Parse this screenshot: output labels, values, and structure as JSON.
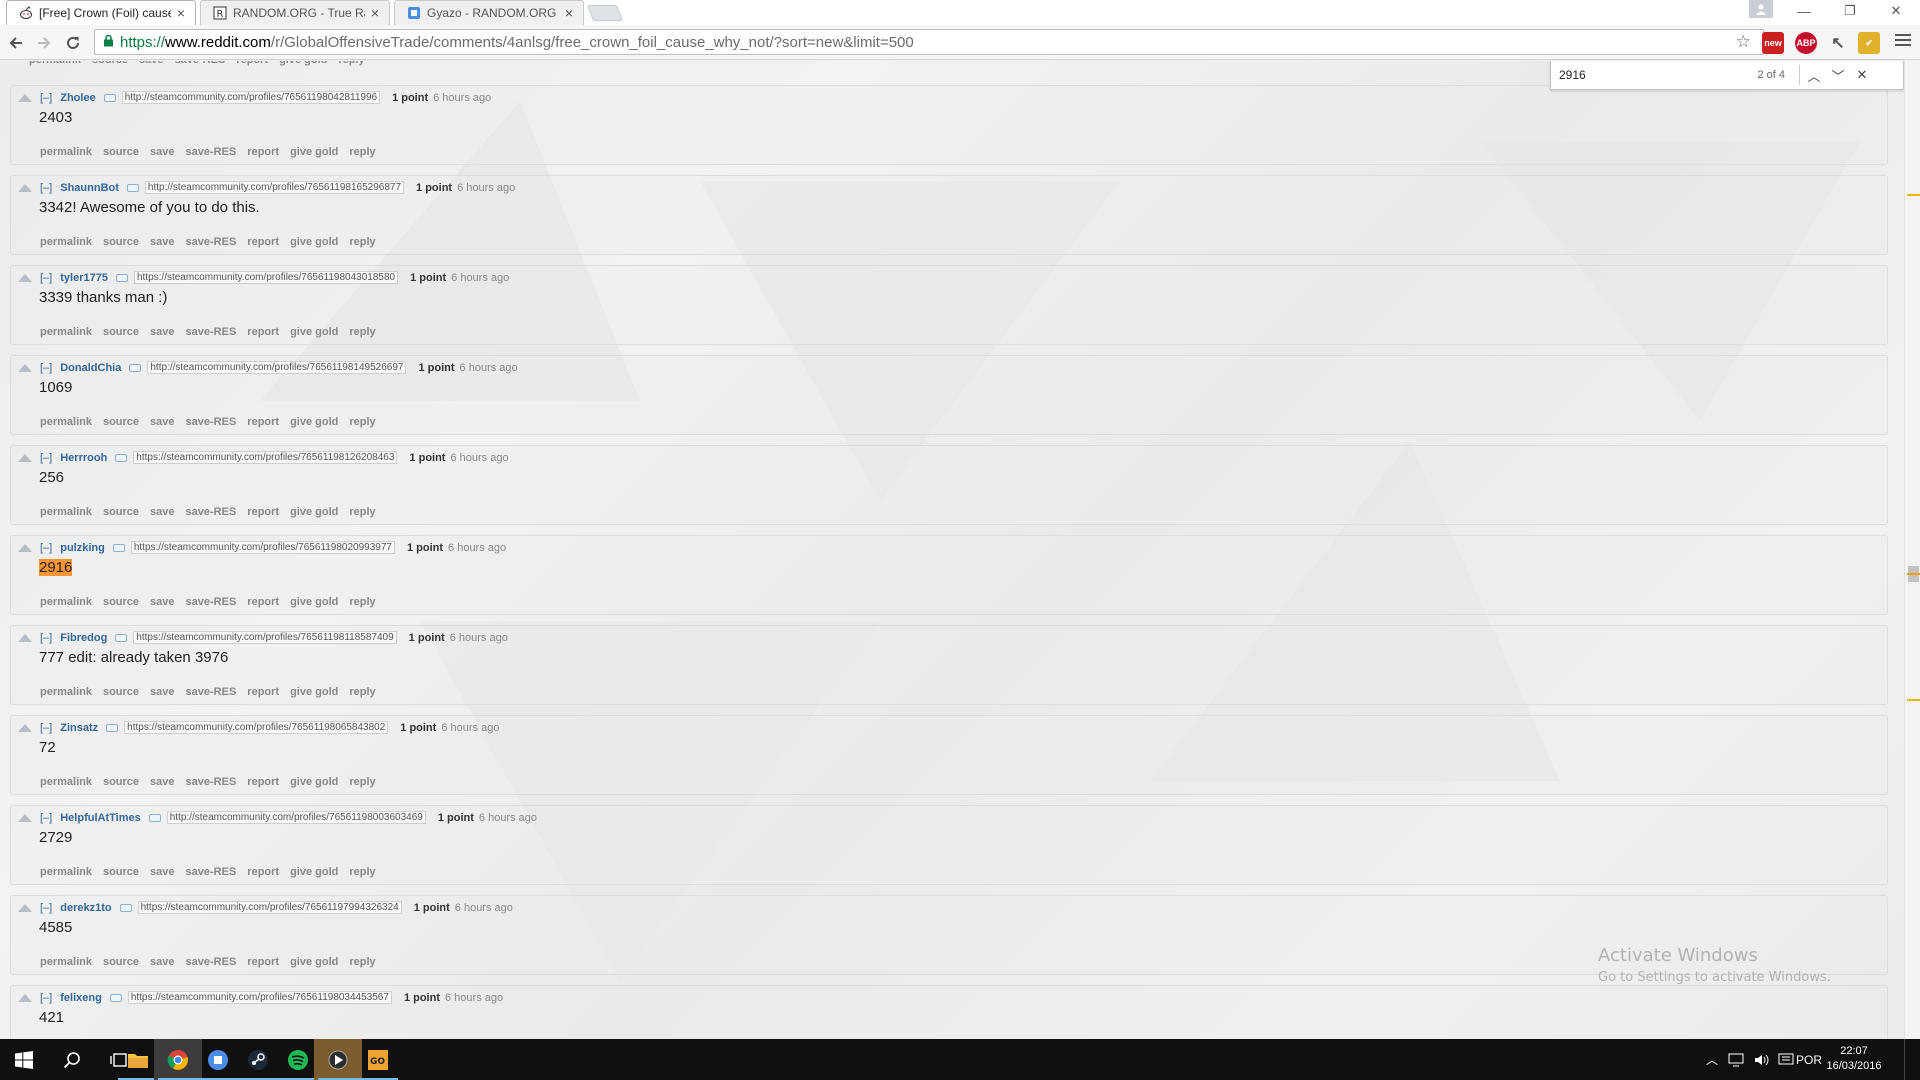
{
  "tabs": [
    {
      "title": "[Free] Crown (Foil) cause",
      "close": "×"
    },
    {
      "title": "RANDOM.ORG - True Ran",
      "close": "×"
    },
    {
      "title": "Gyazo - RANDOM.ORG -",
      "close": "×"
    }
  ],
  "window_controls": {
    "minimize": "—",
    "restore": "❐",
    "close": "✕"
  },
  "toolbar": {
    "url_scheme": "https://",
    "url_host": "www.reddit.com",
    "url_path": "/r/GlobalOffensiveTrade/comments/4anlsg/free_crown_foil_cause_why_not/?sort=new&limit=500",
    "extensions": [
      {
        "name": "mail-new-extension-icon",
        "label": "new",
        "color": "#cc1f1f"
      },
      {
        "name": "adblock-plus-icon",
        "label": "ABP",
        "color": "#c70d2c"
      },
      {
        "name": "cursor-extension-icon",
        "label": "↖",
        "color": "#555555"
      },
      {
        "name": "checkmark-extension-icon",
        "label": "✔",
        "color": "#e1b12c"
      }
    ]
  },
  "findbar": {
    "query": "2916",
    "count": "2 of 4",
    "prev": "︿",
    "next": "﹀",
    "close": "✕"
  },
  "top_buttons": [
    "permalink",
    "source",
    "save",
    "save-RES",
    "report",
    "give gold",
    "reply"
  ],
  "comments": [
    {
      "expand": "[–]",
      "author": "Zholee",
      "flair": "http://steamcommunity.com/profiles/76561198042811996",
      "score": "1 point",
      "time": "6 hours ago",
      "body": "2403",
      "highlight": false
    },
    {
      "expand": "[–]",
      "author": "ShaunnBot",
      "flair": "http://steamcommunity.com/profiles/76561198165296877",
      "score": "1 point",
      "time": "6 hours ago",
      "body": "3342! Awesome of you to do this.",
      "highlight": false
    },
    {
      "expand": "[–]",
      "author": "tyler1775",
      "flair": "https://steamcommunity.com/profiles/76561198043018580",
      "score": "1 point",
      "time": "6 hours ago",
      "body": "3339 thanks man :)",
      "highlight": false
    },
    {
      "expand": "[–]",
      "author": "DonaldChia",
      "flair": "http://steamcommunity.com/profiles/76561198149526697",
      "score": "1 point",
      "time": "6 hours ago",
      "body": "1069",
      "highlight": false
    },
    {
      "expand": "[–]",
      "author": "Herrrooh",
      "flair": "https://steamcommunity.com/profiles/76561198126208463",
      "score": "1 point",
      "time": "6 hours ago",
      "body": "256",
      "highlight": false
    },
    {
      "expand": "[–]",
      "author": "pulzking",
      "flair": "https://steamcommunity.com/profiles/76561198020993977",
      "score": "1 point",
      "time": "6 hours ago",
      "body": "2916",
      "highlight": true
    },
    {
      "expand": "[–]",
      "author": "Fibredog",
      "flair": "https://steamcommunity.com/profiles/76561198118587409",
      "score": "1 point",
      "time": "6 hours ago",
      "body": "777 edit: already taken 3976",
      "highlight": false
    },
    {
      "expand": "[–]",
      "author": "Zinsatz",
      "flair": "https://steamcommunity.com/profiles/76561198065843802",
      "score": "1 point",
      "time": "6 hours ago",
      "body": "72",
      "highlight": false
    },
    {
      "expand": "[–]",
      "author": "HelpfulAtTimes",
      "flair": "http://steamcommunity.com/profiles/76561198003603469",
      "score": "1 point",
      "time": "6 hours ago",
      "body": "2729",
      "highlight": false
    },
    {
      "expand": "[–]",
      "author": "derekz1to",
      "flair": "https://steamcommunity.com/profiles/76561197994326324",
      "score": "1 point",
      "time": "6 hours ago",
      "body": "4585",
      "highlight": false
    },
    {
      "expand": "[–]",
      "author": "felixeng",
      "flair": "https://steamcommunity.com/profiles/76561198034453567",
      "score": "1 point",
      "time": "6 hours ago",
      "body": "421",
      "highlight": false
    }
  ],
  "watermark": {
    "line1": "Activate Windows",
    "line2": "Go to Settings to activate Windows."
  },
  "taskbar": {
    "apps": [
      "start-button",
      "search-icon",
      "task-view-icon",
      "file-explorer-icon",
      "chrome-icon",
      "gyazo-icon",
      "steam-icon",
      "spotify-icon",
      "media-player-icon",
      "csgo-icon"
    ],
    "tray_language": "POR",
    "time": "22:07",
    "date": "16/03/2016"
  }
}
